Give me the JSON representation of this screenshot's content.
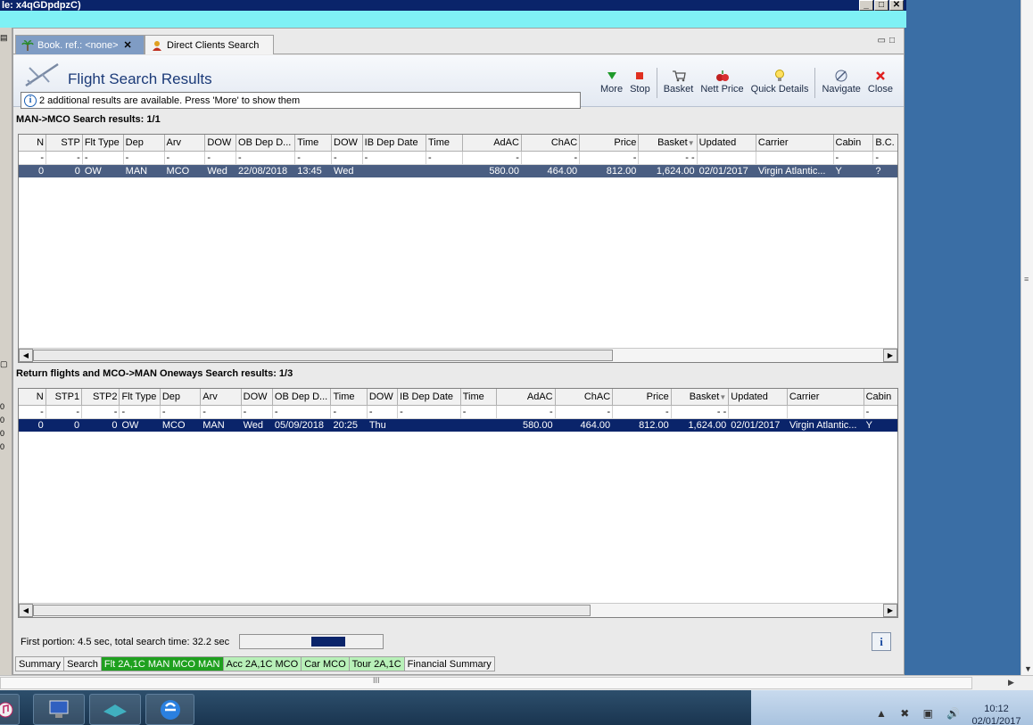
{
  "window": {
    "title": "le: x4qGDpdpzC)",
    "controls": [
      "_",
      "□",
      "✕"
    ]
  },
  "tabs": [
    {
      "label": "Book. ref.: <none>",
      "close": "✕"
    },
    {
      "label": "Direct Clients Search"
    }
  ],
  "tab_window_controls": "▭□",
  "header": {
    "title": "Flight Search Results",
    "info_message": "2 additional results are available. Press 'More' to show them"
  },
  "toolbar": [
    {
      "label": "More",
      "icon": "triangle-down-icon"
    },
    {
      "label": "Stop",
      "icon": "stop-icon"
    },
    {
      "label": "Basket",
      "icon": "basket-icon"
    },
    {
      "label": "Nett Price",
      "icon": "fruit-icon"
    },
    {
      "label": "Quick Details",
      "icon": "lightbulb-icon"
    },
    {
      "label": "Navigate",
      "icon": "navigate-icon"
    },
    {
      "label": "Close",
      "icon": "close-icon"
    }
  ],
  "outbound": {
    "label": "MAN->MCO Search results: 1/1",
    "columns": [
      "N",
      "STP",
      "Flt Type",
      "Dep",
      "Arv",
      "DOW",
      "OB Dep D...",
      "Time",
      "DOW",
      "IB Dep Date",
      "Time",
      "AdAC",
      "ChAC",
      "Price",
      "Basket",
      "Updated",
      "Carrier",
      "Cabin",
      "B.C."
    ],
    "filter_row": [
      "-",
      "-",
      "-",
      "-",
      "-",
      "-",
      "-",
      "-",
      "-",
      "-",
      "-",
      "-",
      "-",
      "-",
      "- -",
      "",
      "",
      "-",
      "-"
    ],
    "rows": [
      [
        "0",
        "0",
        "OW",
        "MAN",
        "MCO",
        "Wed",
        "22/08/2018",
        "13:45",
        "Wed",
        "",
        "",
        "580.00",
        "464.00",
        "812.00",
        "1,624.00",
        "02/01/2017",
        "Virgin Atlantic...",
        "Y",
        "?"
      ]
    ]
  },
  "return": {
    "label": "Return flights and MCO->MAN Oneways Search results: 1/3",
    "columns": [
      "N",
      "STP1",
      "STP2",
      "Flt Type",
      "Dep",
      "Arv",
      "DOW",
      "OB Dep D...",
      "Time",
      "DOW",
      "IB Dep Date",
      "Time",
      "AdAC",
      "ChAC",
      "Price",
      "Basket",
      "Updated",
      "Carrier",
      "Cabin"
    ],
    "filter_row": [
      "-",
      "-",
      "-",
      "-",
      "-",
      "-",
      "-",
      "-",
      "-",
      "-",
      "-",
      "-",
      "-",
      "-",
      "-",
      "- -",
      "",
      "",
      "-"
    ],
    "rows": [
      [
        "0",
        "0",
        "0",
        "OW",
        "MCO",
        "MAN",
        "Wed",
        "05/09/2018",
        "20:25",
        "Thu",
        "",
        "",
        "580.00",
        "464.00",
        "812.00",
        "1,624.00",
        "02/01/2017",
        "Virgin Atlantic...",
        "Y"
      ]
    ]
  },
  "status": {
    "text": "First portion: 4.5 sec, total search time: 32.2 sec",
    "info_button": "i"
  },
  "bottom_tabs": [
    {
      "label": "Summary",
      "style": "plain"
    },
    {
      "label": "Search",
      "style": "plain"
    },
    {
      "label": "Flt 2A,1C MAN MCO MAN",
      "style": "green"
    },
    {
      "label": "Acc 2A,1C MCO",
      "style": "lgreen"
    },
    {
      "label": "Car MCO",
      "style": "lgreen"
    },
    {
      "label": "Tour 2A,1C",
      "style": "lgreen"
    },
    {
      "label": "Financial Summary",
      "style": "plain"
    }
  ],
  "left_strip": [
    "0",
    "0",
    "0",
    "0"
  ],
  "clock": {
    "time": "10:12",
    "date": "02/01/2017"
  },
  "colors": {
    "selected_row": "#0a246a",
    "green_tab": "#1fa01f",
    "title_blue": "#1b3a78"
  }
}
